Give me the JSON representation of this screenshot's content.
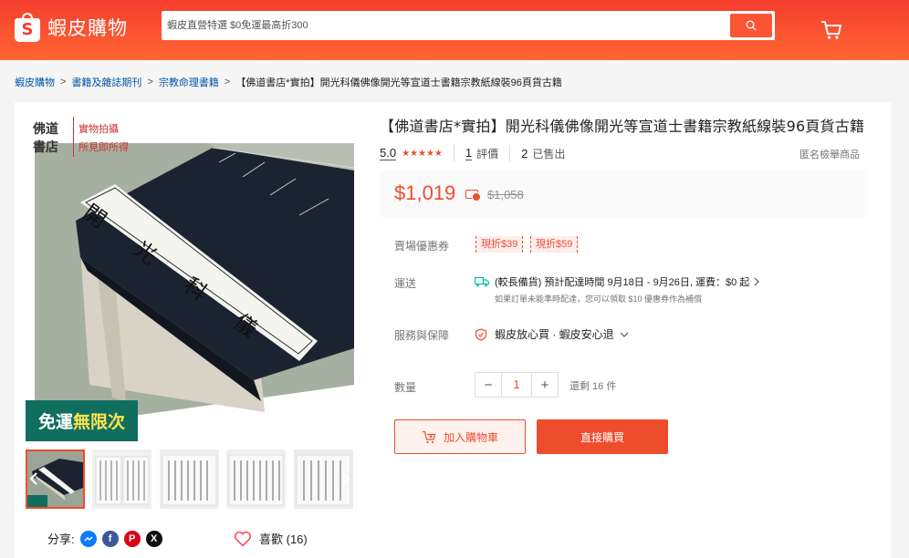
{
  "header": {
    "logo_text": "蝦皮購物",
    "logo_glyph": "S",
    "search_placeholder": "蝦皮直營特選 $0免運最高折300",
    "icons": [
      "search-icon",
      "cart-icon"
    ]
  },
  "breadcrumb": {
    "items": [
      "蝦皮購物",
      "書籍及雜誌期刊",
      "宗教命理書籍"
    ],
    "current": "【佛道書店*實拍】開光科儀佛像開光等宣道士書籍宗教紙線裝96頁貨古籍"
  },
  "gallery": {
    "main_image_text": {
      "store_line1": "佛道",
      "store_line2": "書店",
      "note_line1": "實物拍攝",
      "note_line2": "所見即所得",
      "book_title": [
        "開",
        "光",
        "科",
        "儀"
      ]
    },
    "free_shipping_badge": {
      "prefix": "免運",
      "highlight": "無限次"
    },
    "thumbnail_count": 5
  },
  "share": {
    "label": "分享:",
    "networks": [
      "messenger-icon",
      "facebook-icon",
      "pinterest-icon",
      "x-icon"
    ]
  },
  "like": {
    "label": "喜歡 (16)"
  },
  "product": {
    "title": "【佛道書店*實拍】開光科儀佛像開光等宣道士書籍宗教紙線裝96頁貨古籍",
    "rating": "5.0",
    "stars": 5,
    "reviews_count": "1",
    "reviews_label": "評價",
    "sold_count": "2",
    "sold_label": "已售出",
    "report": "匿名檢舉商品",
    "price": "$1,019",
    "original_price": "$1,058"
  },
  "vouchers": {
    "label": "賣場優惠券",
    "items": [
      "現折$39",
      "現折$59"
    ]
  },
  "shipping": {
    "label": "運送",
    "line": "(較長備貨) 預計配達時間 9月18日 - 9月26日, 運費：$0 起",
    "note": "如果訂單未能準時配達，您可以領取 $10 優惠券作為補償"
  },
  "guarantee": {
    "label": "服務與保障",
    "text": "蝦皮放心買 · 蝦皮安心退"
  },
  "quantity": {
    "label": "數量",
    "value": "1",
    "stock": "還剩 16 件"
  },
  "actions": {
    "add_to_cart": "加入購物車",
    "buy_now": "直接購買"
  },
  "colors": {
    "brand": "#ee4d2d",
    "header": "#f53d2d",
    "badge": "#106e5f"
  }
}
